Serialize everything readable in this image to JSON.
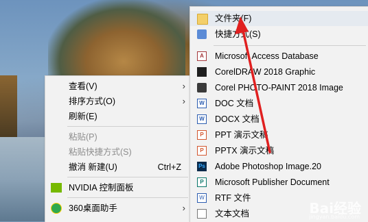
{
  "context_menu": {
    "items": [
      {
        "label": "查看(V)",
        "has_submenu": true,
        "disabled": false
      },
      {
        "label": "排序方式(O)",
        "has_submenu": true,
        "disabled": false
      },
      {
        "label": "刷新(E)",
        "has_submenu": false,
        "disabled": false
      },
      {
        "label": "粘贴(P)",
        "has_submenu": false,
        "disabled": true
      },
      {
        "label": "粘贴快捷方式(S)",
        "has_submenu": false,
        "disabled": true
      },
      {
        "label": "撤消 新建(U)",
        "shortcut": "Ctrl+Z",
        "has_submenu": false,
        "disabled": false
      },
      {
        "label": "NVIDIA 控制面板",
        "icon": "nvidia-icon",
        "has_submenu": false,
        "disabled": false
      },
      {
        "label": "360桌面助手",
        "icon": "360-icon",
        "has_submenu": true,
        "disabled": false
      }
    ]
  },
  "new_submenu": {
    "items": [
      {
        "label": "文件夹(F)",
        "icon": "folder-icon",
        "highlighted": true
      },
      {
        "label": "快捷方式(S)",
        "icon": "shortcut-icon"
      },
      {
        "label": "Microsoft Access Database",
        "icon": "access-icon",
        "icon_text": "A"
      },
      {
        "label": "CorelDRAW 2018 Graphic",
        "icon": "coreldraw-icon"
      },
      {
        "label": "Corel PHOTO-PAINT 2018 Image",
        "icon": "corel-photopaint-icon"
      },
      {
        "label": "DOC 文档",
        "icon": "word-doc-icon",
        "icon_text": "W"
      },
      {
        "label": "DOCX 文档",
        "icon": "word-docx-icon",
        "icon_text": "W"
      },
      {
        "label": "PPT 演示文稿",
        "icon": "ppt-icon",
        "icon_text": "P"
      },
      {
        "label": "PPTX 演示文稿",
        "icon": "pptx-icon",
        "icon_text": "P"
      },
      {
        "label": "Adobe Photoshop Image.20",
        "icon": "photoshop-icon",
        "icon_text": "Ps"
      },
      {
        "label": "Microsoft Publisher Document",
        "icon": "publisher-icon",
        "icon_text": "P"
      },
      {
        "label": "RTF 文件",
        "icon": "rtf-icon",
        "icon_text": "W"
      },
      {
        "label": "文本文档",
        "icon": "text-document-icon"
      }
    ]
  },
  "watermark": {
    "text": "Bai经验",
    "sub": "jingyan.baidu.com"
  },
  "colors": {
    "arrow": "#e02020",
    "menu_bg": "#f2f2f2",
    "highlight": "#e5eaf0"
  }
}
